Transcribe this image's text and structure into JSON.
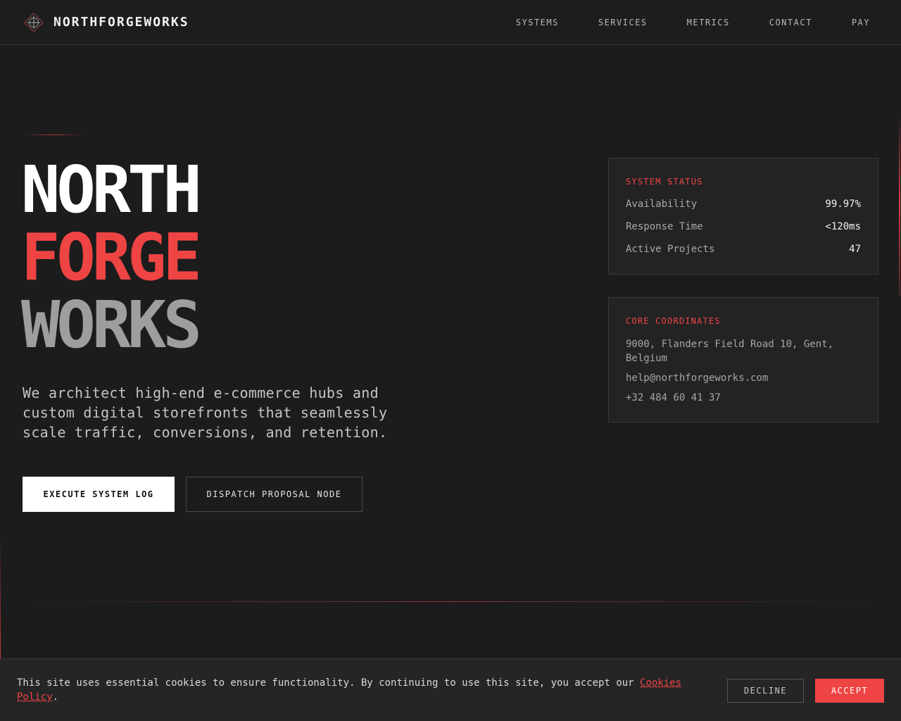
{
  "header": {
    "brand": "NORTHFORGEWORKS",
    "logo_icon": "compass-crosshair-icon",
    "nav": [
      "SYSTEMS",
      "SERVICES",
      "METRICS",
      "CONTACT",
      "PAY"
    ]
  },
  "hero": {
    "title_line1": "NORTH",
    "title_line2": "FORGE",
    "title_line3": "WORKS",
    "tagline": "We architect high-end e-commerce hubs and custom digital storefronts that seamlessly scale traffic, conversions, and retention.",
    "primary_button": "EXECUTE SYSTEM LOG",
    "secondary_button": "DISPATCH PROPOSAL NODE"
  },
  "status_card": {
    "label": "SYSTEM STATUS",
    "rows": [
      {
        "name": "Availability",
        "value": "99.97%"
      },
      {
        "name": "Response Time",
        "value": "<120ms"
      },
      {
        "name": "Active Projects",
        "value": "47"
      }
    ]
  },
  "coords_card": {
    "label": "CORE COORDINATES",
    "address": "9000, Flanders Field Road 10, Gent, Belgium",
    "email": "help@northforgeworks.com",
    "phone": "+32 484 60 41 37"
  },
  "cookie": {
    "text": "This site uses essential cookies to ensure functionality. By continuing to use this site, you accept our ",
    "link": "Cookies Policy",
    "suffix": ".",
    "decline": "DECLINE",
    "accept": "ACCEPT"
  },
  "colors": {
    "accent": "#ef4444",
    "background": "#1c1c1d",
    "card": "#232324"
  }
}
